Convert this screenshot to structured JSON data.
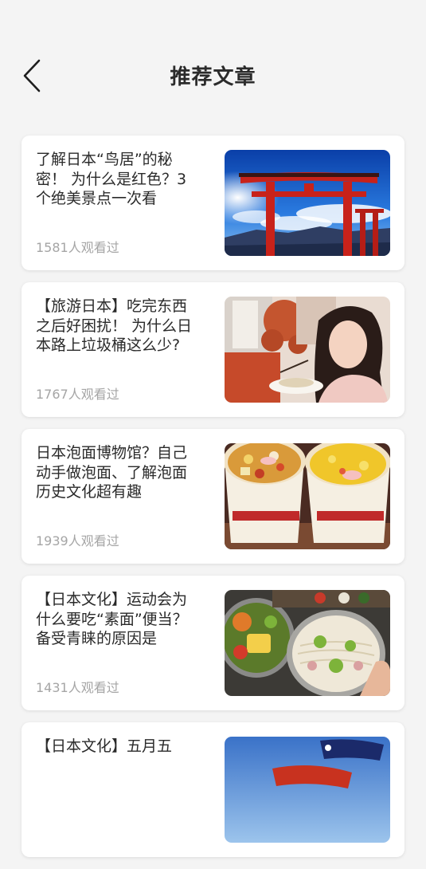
{
  "header": {
    "title": "推荐文章",
    "back_icon": "chevron-left-icon"
  },
  "articles": [
    {
      "title": "了解日本“鸟居”的秘密！ 为什么是红色？3个绝美景点一次看",
      "views": "1581人观看过",
      "image": "torii-gate-photo"
    },
    {
      "title": "【旅游日本】吃完东西之后好困扰！ 为什么日本路上垃圾桶这么少?",
      "views": "1767人观看过",
      "image": "woman-eating-street-food-photo"
    },
    {
      "title": "日本泡面博物馆？自己动手做泡面、了解泡面历史文化超有趣",
      "views": "1939人观看过",
      "image": "cup-noodles-photo"
    },
    {
      "title": "【日本文化】运动会为什么要吃“素面”便当？备受青睐的原因是",
      "views": "1431人观看过",
      "image": "somen-bento-photo"
    },
    {
      "title": "【日本文化】五月五",
      "views": "",
      "image": "koinobori-photo"
    }
  ],
  "colors": {
    "background": "#f4f4f4",
    "card": "#ffffff",
    "title_text": "#2a2a2a",
    "meta_text": "#a5a5a5"
  }
}
